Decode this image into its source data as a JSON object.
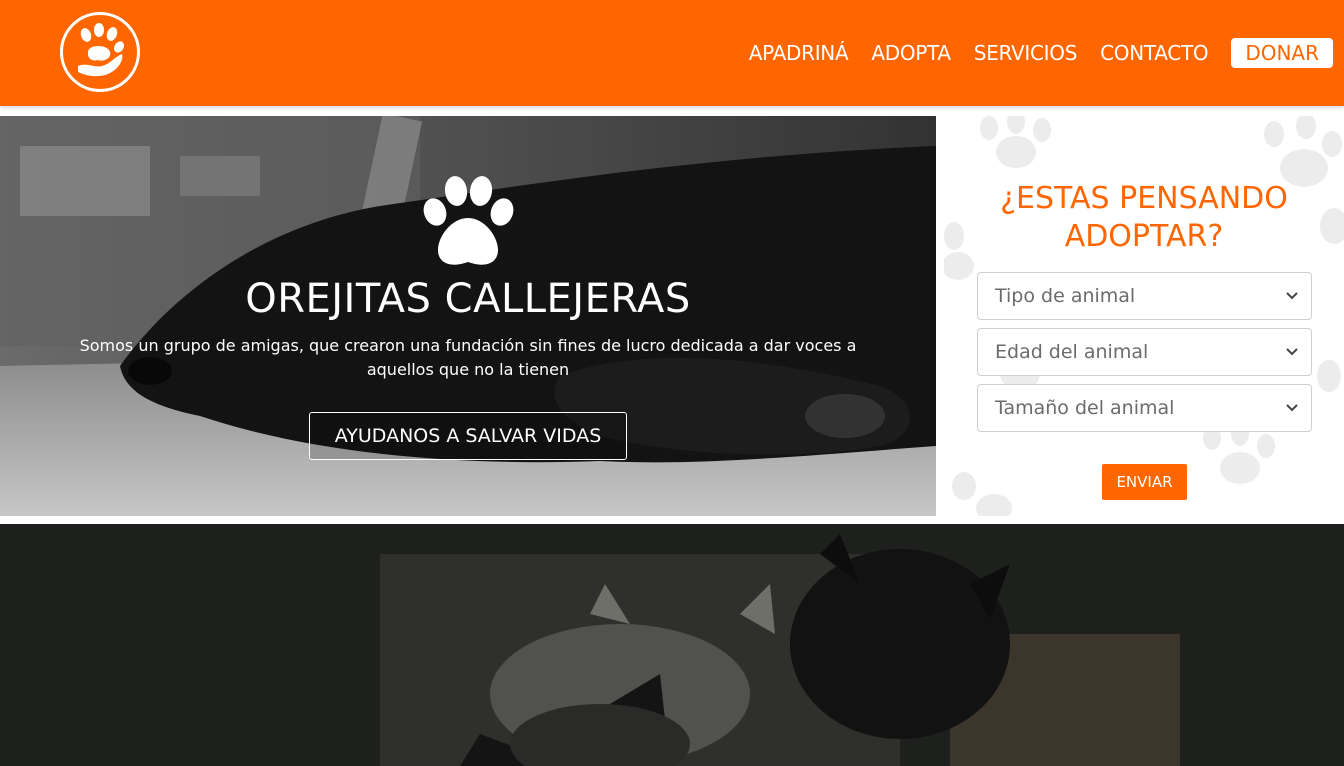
{
  "header": {
    "logo_icon": "paw-hand-icon",
    "nav": [
      {
        "label": "APADRINÁ"
      },
      {
        "label": "ADOPTA"
      },
      {
        "label": "SERVICIOS"
      },
      {
        "label": "CONTACTO"
      }
    ],
    "donate_label": "DONAR"
  },
  "hero": {
    "paw_icon": "paw-icon",
    "title": "OREJITAS CALLEJERAS",
    "text": "Somos un grupo de amigas, que crearon una fundación sin fines de lucro dedicada a dar voces a aquellos que no la tienen",
    "button_label": "AYUDANOS A SALVAR VIDAS"
  },
  "adopt_form": {
    "title": "¿ESTAS PENSANDO ADOPTAR?",
    "selects": [
      {
        "value": "Tipo de animal"
      },
      {
        "value": "Edad del animal"
      },
      {
        "value": "Tamaño del animal"
      }
    ],
    "submit_label": "ENVIAR"
  },
  "colors": {
    "brand": "#ff6600",
    "white": "#ffffff"
  }
}
